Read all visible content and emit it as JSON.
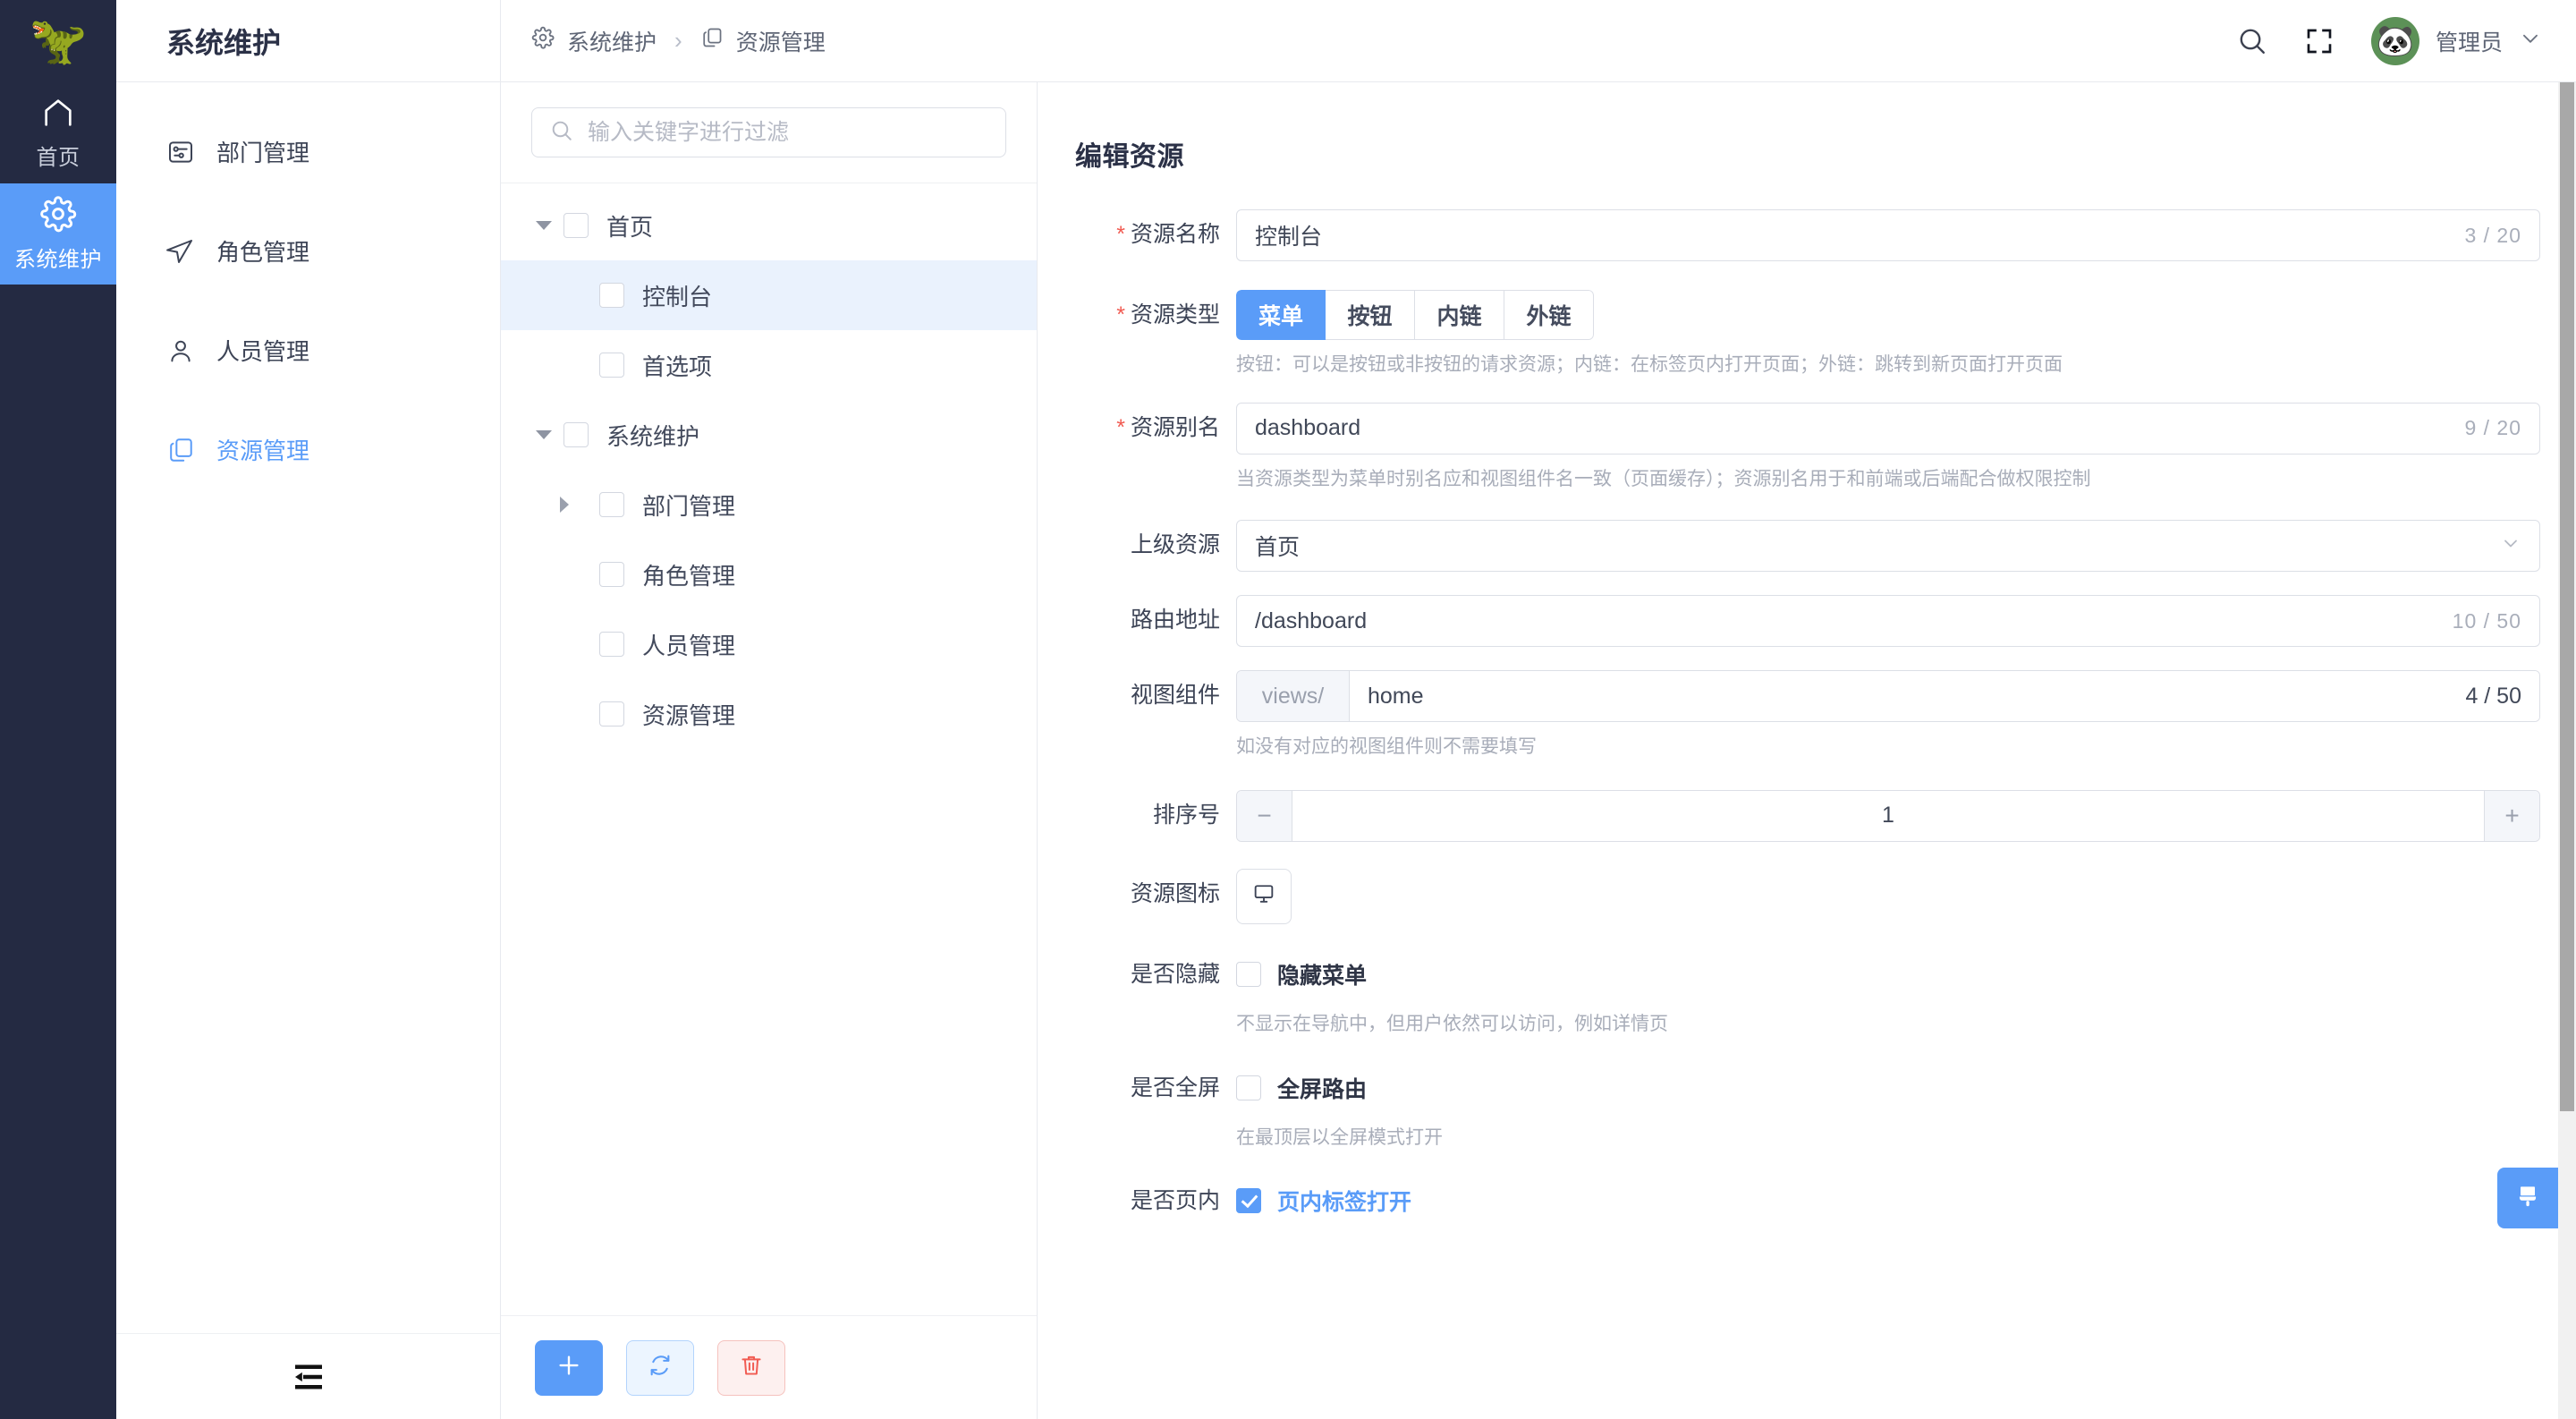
{
  "rail": {
    "logo_icon": "dinosaur-logo",
    "items": [
      {
        "label": "首页",
        "icon": "home-icon",
        "active": false
      },
      {
        "label": "系统维护",
        "icon": "gear-icon",
        "active": true
      }
    ]
  },
  "module_menu": {
    "title": "系统维护",
    "items": [
      {
        "label": "部门管理",
        "icon": "department-icon",
        "active": false
      },
      {
        "label": "角色管理",
        "icon": "navigation-icon",
        "active": false
      },
      {
        "label": "人员管理",
        "icon": "user-icon",
        "active": false
      },
      {
        "label": "资源管理",
        "icon": "copy-icon",
        "active": true
      }
    ],
    "collapse_icon": "menu-collapse-icon"
  },
  "topbar": {
    "breadcrumb": [
      {
        "label": "系统维护",
        "icon": "gear-icon"
      },
      {
        "label": "资源管理",
        "icon": "copy-icon"
      }
    ],
    "separator": "›",
    "search_icon": "search-icon",
    "fullscreen_icon": "fullscreen-icon",
    "user_name": "管理员",
    "user_avatar_icon": "panda-avatar",
    "user_caret_icon": "chevron-down-icon"
  },
  "tree": {
    "search_placeholder": "输入关键字进行过滤",
    "search_value": "",
    "search_icon": "search-icon",
    "nodes": [
      {
        "label": "首页",
        "level": 0,
        "caret": "down",
        "checked": false,
        "selected": false
      },
      {
        "label": "控制台",
        "level": 1,
        "caret": "none",
        "checked": false,
        "selected": true
      },
      {
        "label": "首选项",
        "level": 1,
        "caret": "none",
        "checked": false,
        "selected": false
      },
      {
        "label": "系统维护",
        "level": 0,
        "caret": "down",
        "checked": false,
        "selected": false
      },
      {
        "label": "部门管理",
        "level": 1,
        "caret": "right",
        "checked": false,
        "selected": false
      },
      {
        "label": "角色管理",
        "level": 1,
        "caret": "none",
        "checked": false,
        "selected": false
      },
      {
        "label": "人员管理",
        "level": 1,
        "caret": "none",
        "checked": false,
        "selected": false
      },
      {
        "label": "资源管理",
        "level": 1,
        "caret": "none",
        "checked": false,
        "selected": false
      }
    ],
    "toolbar": [
      {
        "name": "add-button",
        "icon": "plus-icon",
        "style": "primary"
      },
      {
        "name": "refresh-button",
        "icon": "refresh-icon",
        "style": "info"
      },
      {
        "name": "delete-button",
        "icon": "trash-icon",
        "style": "danger"
      }
    ]
  },
  "form": {
    "title": "编辑资源",
    "resource_name": {
      "label": "资源名称",
      "required": true,
      "value": "控制台",
      "counter": "3 / 20"
    },
    "resource_type": {
      "label": "资源类型",
      "required": true,
      "options": [
        "菜单",
        "按钮",
        "内链",
        "外链"
      ],
      "selected": "菜单",
      "hint": "按钮：可以是按钮或非按钮的请求资源；内链：在标签页内打开页面；外链：跳转到新页面打开页面"
    },
    "resource_alias": {
      "label": "资源别名",
      "required": true,
      "value": "dashboard",
      "counter": "9 / 20",
      "hint": "当资源类型为菜单时别名应和视图组件名一致（页面缓存）；资源别名用于和前端或后端配合做权限控制"
    },
    "parent_resource": {
      "label": "上级资源",
      "required": false,
      "value": "首页",
      "caret_icon": "chevron-down-icon"
    },
    "route_path": {
      "label": "路由地址",
      "required": false,
      "value": "/dashboard",
      "counter": "10 / 50"
    },
    "view_component": {
      "label": "视图组件",
      "required": false,
      "prefix": "views/",
      "value": "home",
      "counter": "4 / 50",
      "hint": "如没有对应的视图组件则不需要填写"
    },
    "sort_number": {
      "label": "排序号",
      "required": false,
      "value": "1",
      "minus_icon": "minus-icon",
      "plus_icon": "plus-icon"
    },
    "resource_icon": {
      "label": "资源图标",
      "required": false,
      "icon": "monitor-icon"
    },
    "hidden": {
      "label": "是否隐藏",
      "checkbox_label": "隐藏菜单",
      "checked": false,
      "hint": "不显示在导航中，但用户依然可以访问，例如详情页"
    },
    "fullscreen": {
      "label": "是否全屏",
      "checkbox_label": "全屏路由",
      "checked": false,
      "hint": "在最顶层以全屏模式打开"
    },
    "cached": {
      "label": "是否页内",
      "checkbox_label": "页内标签打开",
      "checked": true
    }
  },
  "theme_fab": {
    "icon": "paintbrush-icon"
  },
  "colors": {
    "rail_bg": "#242a42",
    "accent": "#5a9cf8",
    "selected_row": "#eaf2fd",
    "required_star": "#f15b52",
    "danger": "#f15b52"
  }
}
